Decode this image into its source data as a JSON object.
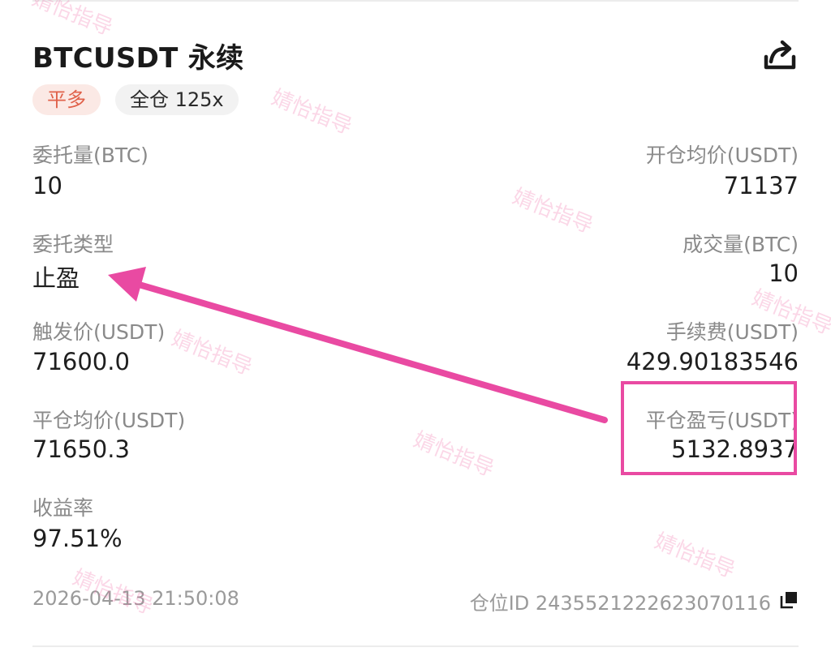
{
  "header": {
    "symbol": "BTCUSDT 永续",
    "side_badge": "平多",
    "margin_badge": "全仓 125x"
  },
  "fields": {
    "order_qty": {
      "label": "委托量(BTC)",
      "value": "10"
    },
    "avg_open": {
      "label": "开仓均价(USDT)",
      "value": "71137"
    },
    "order_type": {
      "label": "委托类型",
      "value": "止盈"
    },
    "filled_qty": {
      "label": "成交量(BTC)",
      "value": "10"
    },
    "trigger": {
      "label": "触发价(USDT)",
      "value": "71600.0"
    },
    "fee": {
      "label": "手续费(USDT)",
      "value": "429.90183546"
    },
    "avg_close": {
      "label": "平仓均价(USDT)",
      "value": "71650.3"
    },
    "pnl": {
      "label": "平仓盈亏(USDT)",
      "value": "5132.8937"
    },
    "roi": {
      "label": "收益率",
      "value": "97.51%"
    }
  },
  "footer": {
    "timestamp": "2026-04-13 21:50:08",
    "position_id": "仓位ID 2435521222623070116"
  },
  "watermark": {
    "text": "婧怡指导",
    "color": "#f06eaa"
  },
  "annotation_color": "#e94aa2",
  "icons": {
    "share": "share-icon",
    "copy": "copy-icon"
  }
}
